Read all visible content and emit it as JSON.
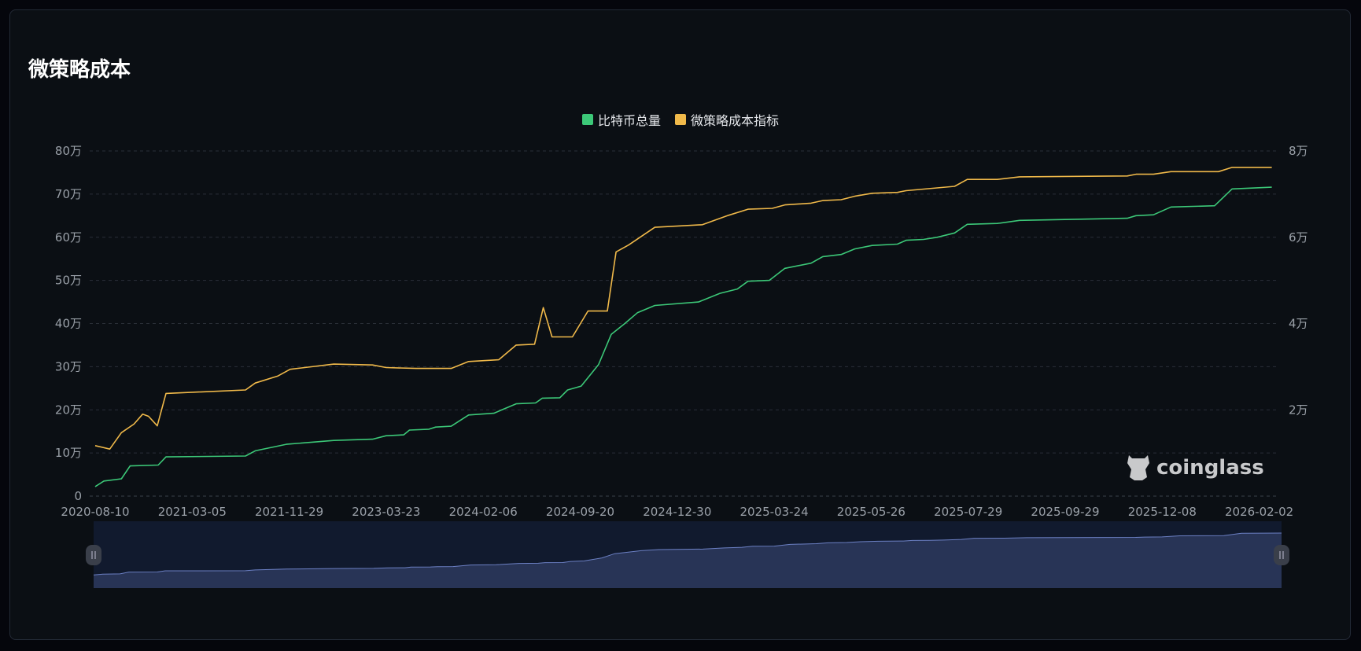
{
  "title": "微策略成本",
  "watermark": "coinglass",
  "colors": {
    "green": "#3cc878",
    "yellow": "#f0b94a",
    "grid": "#2a2f38",
    "slider_bg": "#111a2e",
    "slider_area": "#283456",
    "slider_line": "#6c80c4"
  },
  "chart_data": {
    "type": "line",
    "title": "微策略成本",
    "legend_position": "top-center",
    "x_ticks": [
      "2020-08-10",
      "2021-03-05",
      "2021-11-29",
      "2023-03-23",
      "2024-02-06",
      "2024-09-20",
      "2024-12-30",
      "2025-03-24",
      "2025-05-26",
      "2025-07-29",
      "2025-09-29",
      "2025-12-08",
      "2026-02-02"
    ],
    "x_note": "x values are positions in tick-index units",
    "left_axis": {
      "ticks": [
        "0",
        "10万",
        "20万",
        "30万",
        "40万",
        "50万",
        "60万",
        "70万",
        "80万"
      ],
      "range": [
        0,
        800000
      ]
    },
    "right_axis": {
      "ticks": [
        "2万",
        "4万",
        "6万",
        "8万"
      ],
      "range": [
        0,
        80000
      ]
    },
    "grid": true,
    "series": [
      {
        "name": "比特币总量",
        "axis": "left",
        "unit": "万",
        "points": [
          [
            0,
            2.2
          ],
          [
            0.09,
            3.5
          ],
          [
            0.27,
            4
          ],
          [
            0.36,
            7
          ],
          [
            0.65,
            7.2
          ],
          [
            0.73,
            9.1
          ],
          [
            1.55,
            9.3
          ],
          [
            1.65,
            10.5
          ],
          [
            1.97,
            12
          ],
          [
            2.46,
            12.9
          ],
          [
            2.86,
            13.2
          ],
          [
            3.0,
            14
          ],
          [
            3.18,
            14.2
          ],
          [
            3.24,
            15.3
          ],
          [
            3.44,
            15.5
          ],
          [
            3.51,
            16
          ],
          [
            3.67,
            16.2
          ],
          [
            3.85,
            18.8
          ],
          [
            4.11,
            19.2
          ],
          [
            4.34,
            21.4
          ],
          [
            4.54,
            21.6
          ],
          [
            4.61,
            22.7
          ],
          [
            4.79,
            22.8
          ],
          [
            4.87,
            24.6
          ],
          [
            5.01,
            25.5
          ],
          [
            5.19,
            30.5
          ],
          [
            5.32,
            37.5
          ],
          [
            5.46,
            40
          ],
          [
            5.59,
            42.5
          ],
          [
            5.77,
            44.2
          ],
          [
            6.22,
            45
          ],
          [
            6.44,
            47
          ],
          [
            6.62,
            48
          ],
          [
            6.73,
            49.8
          ],
          [
            6.95,
            50
          ],
          [
            7.11,
            52.8
          ],
          [
            7.38,
            54
          ],
          [
            7.5,
            55.5
          ],
          [
            7.69,
            56
          ],
          [
            7.83,
            57.3
          ],
          [
            8.01,
            58.1
          ],
          [
            8.27,
            58.4
          ],
          [
            8.36,
            59.3
          ],
          [
            8.54,
            59.5
          ],
          [
            8.68,
            60
          ],
          [
            8.86,
            61
          ],
          [
            8.99,
            63
          ],
          [
            9.3,
            63.2
          ],
          [
            9.53,
            63.9
          ],
          [
            10.64,
            64.4
          ],
          [
            10.73,
            65
          ],
          [
            10.91,
            65.2
          ],
          [
            11.09,
            67
          ],
          [
            11.54,
            67.3
          ],
          [
            11.72,
            71.2
          ],
          [
            12.13,
            71.6
          ]
        ]
      },
      {
        "name": "微策略成本指标",
        "axis": "right",
        "unit": "万",
        "points": [
          [
            0,
            1.17
          ],
          [
            0.15,
            1.09
          ],
          [
            0.27,
            1.47
          ],
          [
            0.4,
            1.67
          ],
          [
            0.49,
            1.9
          ],
          [
            0.55,
            1.85
          ],
          [
            0.64,
            1.63
          ],
          [
            0.73,
            2.38
          ],
          [
            1.55,
            2.46
          ],
          [
            1.65,
            2.62
          ],
          [
            1.88,
            2.78
          ],
          [
            2.01,
            2.94
          ],
          [
            2.46,
            3.06
          ],
          [
            2.86,
            3.04
          ],
          [
            3.0,
            2.98
          ],
          [
            3.31,
            2.96
          ],
          [
            3.67,
            2.96
          ],
          [
            3.85,
            3.12
          ],
          [
            4.16,
            3.16
          ],
          [
            4.34,
            3.5
          ],
          [
            4.53,
            3.52
          ],
          [
            4.62,
            4.37
          ],
          [
            4.71,
            3.69
          ],
          [
            4.92,
            3.69
          ],
          [
            5.08,
            4.29
          ],
          [
            5.28,
            4.29
          ],
          [
            5.37,
            5.66
          ],
          [
            5.5,
            5.82
          ],
          [
            5.77,
            6.23
          ],
          [
            6.26,
            6.29
          ],
          [
            6.53,
            6.51
          ],
          [
            6.73,
            6.65
          ],
          [
            6.98,
            6.67
          ],
          [
            7.11,
            6.75
          ],
          [
            7.38,
            6.79
          ],
          [
            7.5,
            6.85
          ],
          [
            7.69,
            6.87
          ],
          [
            7.83,
            6.95
          ],
          [
            8.01,
            7.02
          ],
          [
            8.27,
            7.04
          ],
          [
            8.36,
            7.08
          ],
          [
            8.86,
            7.18
          ],
          [
            8.99,
            7.34
          ],
          [
            9.3,
            7.34
          ],
          [
            9.53,
            7.4
          ],
          [
            10.64,
            7.42
          ],
          [
            10.73,
            7.46
          ],
          [
            10.91,
            7.46
          ],
          [
            11.09,
            7.52
          ],
          [
            11.58,
            7.52
          ],
          [
            11.72,
            7.62
          ],
          [
            12.13,
            7.62
          ]
        ]
      }
    ]
  }
}
